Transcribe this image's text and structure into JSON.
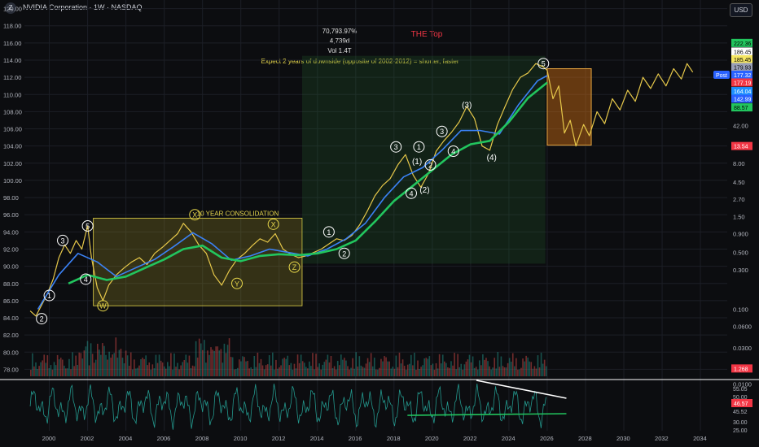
{
  "header": {
    "title": "NVIDIA Corporation · 1W · NASDAQ",
    "currency": "USD",
    "logo": "Z"
  },
  "stats": {
    "percent": "70,793.97%",
    "duration": "4,739d",
    "volume": "Vol 1.4T",
    "note": "Expect 2 years of downside (opposite of 2002-2012) = shorter, faster",
    "top_label": "THE Top"
  },
  "annotations": {
    "consolidation": "10 YEAR CONSOLIDATION",
    "waves": [
      {
        "label": "1",
        "year": 2000.0,
        "price": 86.6
      },
      {
        "label": "2",
        "year": 1999.6,
        "price": 83.9
      },
      {
        "label": "3",
        "year": 2000.7,
        "price": 93.0
      },
      {
        "label": "4",
        "year": 2001.9,
        "price": 88.5
      },
      {
        "label": "5",
        "year": 2002.0,
        "price": 94.7
      },
      {
        "label": "W",
        "year": 2002.8,
        "price": 85.4
      },
      {
        "label": "X",
        "year": 2007.6,
        "price": 96.0
      },
      {
        "label": "Y",
        "year": 2009.8,
        "price": 88.0
      },
      {
        "label": "X",
        "year": 2011.7,
        "price": 94.9
      },
      {
        "label": "Z",
        "year": 2012.8,
        "price": 89.9
      },
      {
        "label": "1",
        "year": 2014.6,
        "price": 94.0
      },
      {
        "label": "2",
        "year": 2015.4,
        "price": 91.5
      },
      {
        "label": "3",
        "year": 2018.1,
        "price": 103.9
      },
      {
        "label": "(1)",
        "year": 2019.2,
        "price": 102.2
      },
      {
        "label": "4",
        "year": 2018.9,
        "price": 98.5
      },
      {
        "label": "(2)",
        "year": 2019.6,
        "price": 98.9
      },
      {
        "label": "1",
        "year": 2019.3,
        "price": 103.9
      },
      {
        "label": "2",
        "year": 2019.9,
        "price": 101.8
      },
      {
        "label": "3",
        "year": 2020.5,
        "price": 105.7
      },
      {
        "label": "4",
        "year": 2021.1,
        "price": 103.4
      },
      {
        "label": "(3)",
        "year": 2021.8,
        "price": 108.8
      },
      {
        "label": "(4)",
        "year": 2023.1,
        "price": 102.7
      },
      {
        "label": "5",
        "year": 2025.8,
        "price": 113.6
      }
    ]
  },
  "right_axis_badges": [
    {
      "text": "222.36",
      "color": "#22c55e",
      "textColor": "#000000",
      "price": 116.0
    },
    {
      "text": "186.45",
      "color": "#ffffff",
      "textColor": "#000000",
      "price": 115.0
    },
    {
      "text": "185.45",
      "color": "#f5e663",
      "textColor": "#000000",
      "price": 114.1
    },
    {
      "text": "179.93",
      "color": "#9aa0b8",
      "textColor": "#000000",
      "price": 113.2
    },
    {
      "text": "177.32",
      "color": "#2962ff",
      "textColor": "#ffffff",
      "price": 112.3
    },
    {
      "text": "177.19",
      "color": "#f23645",
      "textColor": "#ffffff",
      "price": 111.4
    },
    {
      "text": "164.04",
      "color": "#1e90ff",
      "textColor": "#ffffff",
      "price": 110.4
    },
    {
      "text": "142.99",
      "color": "#2962ff",
      "textColor": "#ffffff",
      "price": 109.5
    },
    {
      "text": "88.57",
      "color": "#22c55e",
      "textColor": "#000000",
      "price": 108.5
    },
    {
      "text": "13.54",
      "color": "#f23645",
      "textColor": "#ffffff",
      "price": 104.0
    },
    {
      "text": "1.268",
      "color": "#f23645",
      "textColor": "#ffffff",
      "price": 78.1
    }
  ],
  "post_label": "Post",
  "chart_data": {
    "type": "line",
    "title": "NVIDIA Corporation · 1W · NASDAQ",
    "xlabel": "",
    "ylabel": "",
    "x_ticks": [
      "2000",
      "2002",
      "2004",
      "2006",
      "2008",
      "2010",
      "2012",
      "2014",
      "2016",
      "2018",
      "2020",
      "2022",
      "2024",
      "2026",
      "2028",
      "2030",
      "2032",
      "2034"
    ],
    "xlim": [
      1998.7,
      2035.4
    ],
    "y_ticks_left": [
      120,
      118,
      116,
      114,
      112,
      110,
      108,
      106,
      104,
      102,
      100,
      98,
      96,
      94,
      92,
      90,
      88,
      86,
      84,
      82,
      80,
      78
    ],
    "ylim_left": [
      77.0,
      121.0
    ],
    "y_ticks_right": [
      "42.00",
      "24.00",
      "13.54",
      "8.00",
      "4.50",
      "2.70",
      "1.50",
      "0.900",
      "0.500",
      "0.300",
      "0.100",
      "0.0600",
      "0.0300",
      "0.0100"
    ],
    "y_ticks_right_price": [
      106.4,
      104.1,
      104.0,
      102.0,
      99.8,
      97.8,
      95.8,
      93.8,
      91.6,
      89.6,
      85.0,
      83.0,
      80.5,
      76.3
    ],
    "series": [
      {
        "name": "",
        "color": "#e6c84a",
        "x": [
          1999.0,
          1999.3,
          1999.6,
          1999.9,
          2000.2,
          2000.5,
          2000.8,
          2001.1,
          2001.4,
          2001.7,
          2002.0,
          2002.2,
          2002.5,
          2002.8,
          2003.1,
          2003.5,
          2003.9,
          2004.3,
          2004.7,
          2005.1,
          2005.5,
          2005.9,
          2006.3,
          2006.7,
          2007.0,
          2007.4,
          2007.8,
          2008.2,
          2008.6,
          2009.0,
          2009.4,
          2009.8,
          2010.2,
          2010.6,
          2011.0,
          2011.4,
          2011.8,
          2012.2,
          2012.6,
          2013.0,
          2013.4,
          2013.8,
          2014.2,
          2014.6,
          2015.0,
          2015.4,
          2015.8,
          2016.2,
          2016.6,
          2017.0,
          2017.4,
          2017.8,
          2018.2,
          2018.6,
          2019.0,
          2019.4,
          2019.8,
          2020.2,
          2020.6,
          2021.0,
          2021.4,
          2021.8,
          2022.2,
          2022.6,
          2023.0,
          2023.4,
          2023.8,
          2024.2,
          2024.6,
          2025.0,
          2025.4,
          2025.8,
          2026.0
        ],
        "y": [
          84.8,
          84.2,
          85.5,
          86.8,
          88.5,
          91.0,
          92.5,
          91.5,
          93.0,
          92.0,
          94.7,
          91.0,
          87.5,
          86.0,
          87.8,
          89.0,
          89.8,
          90.5,
          91.0,
          90.2,
          91.5,
          92.2,
          93.0,
          93.8,
          95.0,
          94.0,
          92.5,
          91.5,
          89.0,
          87.8,
          89.5,
          90.8,
          91.5,
          92.4,
          93.2,
          92.8,
          93.8,
          92.0,
          91.4,
          91.0,
          91.2,
          91.6,
          92.0,
          92.6,
          93.2,
          93.0,
          93.6,
          94.8,
          96.4,
          98.2,
          99.4,
          100.2,
          101.8,
          103.0,
          100.6,
          99.2,
          100.8,
          103.4,
          104.6,
          105.6,
          106.8,
          108.6,
          107.2,
          104.0,
          103.5,
          106.5,
          108.6,
          110.6,
          112.0,
          112.5,
          113.6,
          113.2,
          112.8
        ]
      },
      {
        "name": "",
        "color": "#3b82f6",
        "x": [
          1999.4,
          2000.5,
          2001.5,
          2002.5,
          2003.5,
          2004.5,
          2005.5,
          2006.5,
          2007.5,
          2008.5,
          2009.5,
          2010.5,
          2011.5,
          2012.5,
          2013.5,
          2014.5,
          2015.5,
          2016.5,
          2017.5,
          2018.5,
          2019.5,
          2020.5,
          2021.5,
          2022.5,
          2023.5,
          2024.5,
          2025.5,
          2026.0
        ],
        "y": [
          85.0,
          89.0,
          91.5,
          90.5,
          88.8,
          89.8,
          90.8,
          92.3,
          93.9,
          92.6,
          90.7,
          91.2,
          92.0,
          91.6,
          91.2,
          92.0,
          93.2,
          95.0,
          98.0,
          100.4,
          101.5,
          103.5,
          105.8,
          105.8,
          105.4,
          108.8,
          111.6,
          112.2
        ]
      },
      {
        "name": "",
        "color": "#22c55e",
        "x": [
          2001.0,
          2002.0,
          2003.0,
          2004.0,
          2005.0,
          2006.0,
          2007.0,
          2008.0,
          2009.0,
          2010.0,
          2011.0,
          2012.0,
          2013.0,
          2014.0,
          2015.0,
          2016.0,
          2017.0,
          2018.0,
          2019.0,
          2020.0,
          2021.0,
          2022.0,
          2023.0,
          2024.0,
          2025.0,
          2026.0
        ],
        "y": [
          88.0,
          89.0,
          88.4,
          88.8,
          89.8,
          90.8,
          92.0,
          92.4,
          91.0,
          90.6,
          91.2,
          91.4,
          91.3,
          91.5,
          92.0,
          93.0,
          95.2,
          97.6,
          99.4,
          101.2,
          103.0,
          104.2,
          104.6,
          106.8,
          109.6,
          111.4
        ]
      },
      {
        "name": "",
        "color": "#e6c84a",
        "x": [
          2026.0,
          2026.3,
          2026.6,
          2026.9,
          2027.2,
          2027.5,
          2027.9,
          2028.2,
          2028.6,
          2029.0,
          2029.4,
          2029.8,
          2030.2,
          2030.6,
          2031.0,
          2031.4,
          2031.8,
          2032.2,
          2032.6,
          2033.0,
          2033.3,
          2033.6
        ],
        "y": [
          112.8,
          109.5,
          111.0,
          105.5,
          107.0,
          104.0,
          106.5,
          105.2,
          108.0,
          106.6,
          109.5,
          108.2,
          110.5,
          109.2,
          112.0,
          110.7,
          112.4,
          111.0,
          113.0,
          111.8,
          113.6,
          112.6
        ]
      }
    ],
    "oscillator": {
      "y_ticks": [
        "55.05",
        "50.00",
        "46.57",
        "45.52",
        "30.00",
        "25.00"
      ],
      "level": 46.57
    }
  }
}
